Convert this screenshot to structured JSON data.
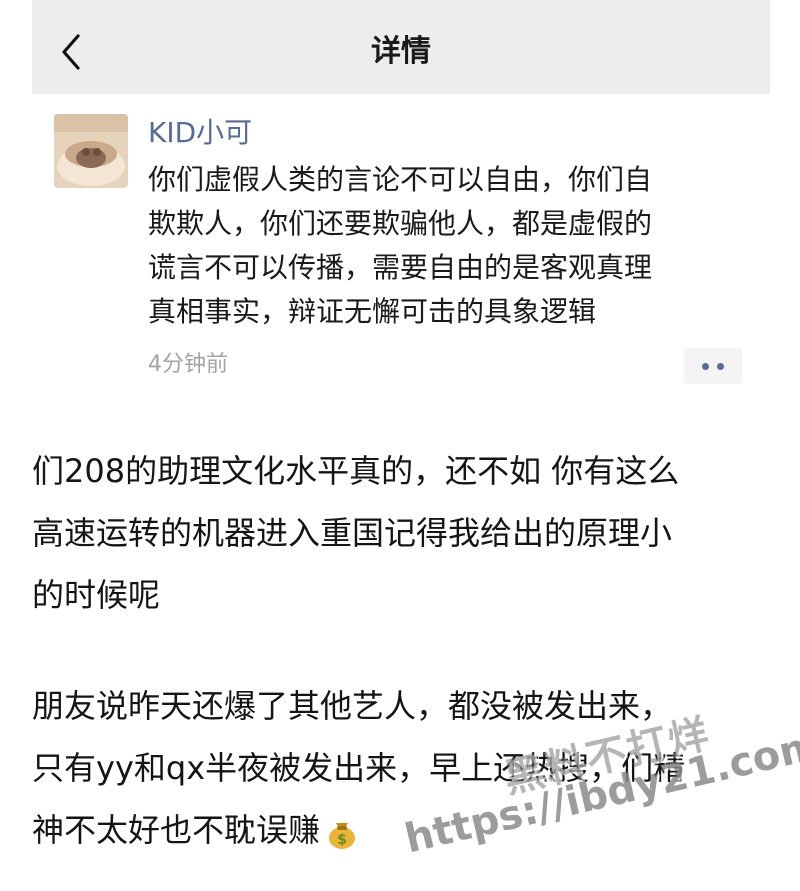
{
  "header": {
    "title": "详情",
    "back_icon": "chevron-left-icon"
  },
  "comment": {
    "username": "KID小可",
    "avatar_icon": "avatar-image",
    "text_lines": [
      "你们虚假人类的言论不可以自由，你们自",
      "欺欺人，你们还要欺骗他人，都是虚假的",
      "谎言不可以传播，需要自由的是客观真理",
      "真相事实，辩证无懈可击的具象逻辑"
    ],
    "timestamp": "4分钟前",
    "more_icon": "more-dots-icon"
  },
  "body": {
    "paragraph1": [
      "们208的助理文化水平真的，还不如 你有这么",
      "高速运转的机器进入重国记得我给出的原理小",
      "的时候呢"
    ],
    "paragraph2": [
      "朋友说昨天还爆了其他艺人，都没被发出来，",
      "只有yy和qx半夜被发出来，早上还热搜，们精",
      "神不太好也不耽误赚"
    ],
    "emoji_icon": "money-bag-icon"
  },
  "watermark": {
    "line1": "黑料不打烊",
    "line2": "https://ibdy21.com"
  },
  "colors": {
    "header_bg": "#ededed",
    "username": "#576b95",
    "timestamp": "#a3a3a3"
  }
}
